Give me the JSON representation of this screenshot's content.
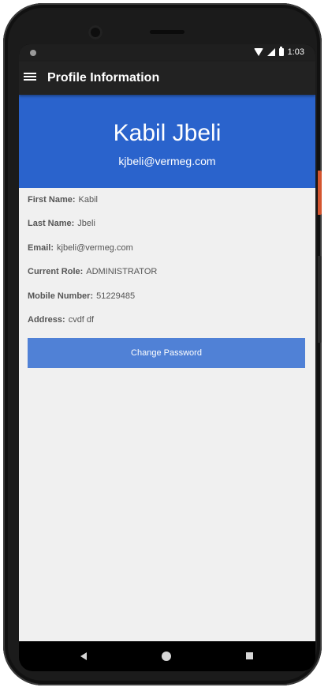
{
  "status_bar": {
    "time": "1:03",
    "icons": [
      "notification-dot-icon",
      "wifi-icon",
      "signal-icon",
      "battery-icon"
    ]
  },
  "app_bar": {
    "menu_icon": "menu-icon",
    "title": "Profile Information"
  },
  "header": {
    "name": "Kabil Jbeli",
    "email": "kjbeli@vermeg.com",
    "background_color": "#2a63cc"
  },
  "profile_fields": [
    {
      "label": "First Name:",
      "value": "Kabil"
    },
    {
      "label": "Last Name:",
      "value": "Jbeli"
    },
    {
      "label": "Email:",
      "value": "kjbeli@vermeg.com"
    },
    {
      "label": "Current Role:",
      "value": "ADMINISTRATOR"
    },
    {
      "label": "Mobile Number:",
      "value": "51229485"
    },
    {
      "label": "Address:",
      "value": "cvdf df"
    }
  ],
  "actions": {
    "change_password_label": "Change Password",
    "button_color": "#5081d6"
  },
  "nav_bar": {
    "icons": [
      "back-icon",
      "home-icon",
      "recents-icon"
    ]
  }
}
